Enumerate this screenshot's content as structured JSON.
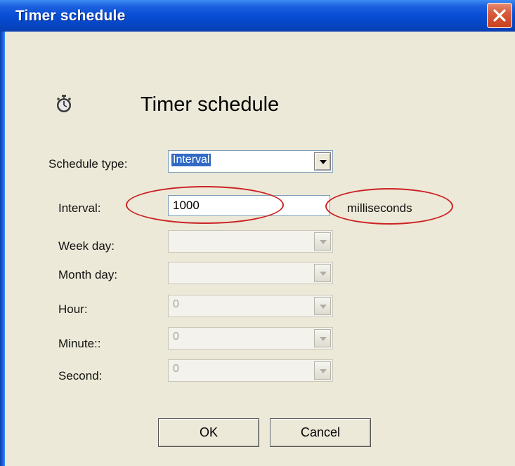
{
  "window": {
    "title": "Timer schedule"
  },
  "header": {
    "icon": "stopwatch-icon",
    "title": "Timer schedule"
  },
  "form": {
    "schedule_type": {
      "label": "Schedule type:",
      "value": "Interval"
    },
    "interval": {
      "label": "Interval:",
      "value": "1000",
      "unit": "milliseconds"
    },
    "week_day": {
      "label": "Week day:",
      "value": ""
    },
    "month_day": {
      "label": "Month day:",
      "value": ""
    },
    "hour": {
      "label": "Hour:",
      "value": "0"
    },
    "minute": {
      "label": "Minute::",
      "value": "0"
    },
    "second": {
      "label": "Second:",
      "value": "0"
    }
  },
  "buttons": {
    "ok": "OK",
    "cancel": "Cancel"
  },
  "colors": {
    "title_bar": "#0a4fd6",
    "dialog_bg": "#ece9d8",
    "annotation": "#cc2222"
  }
}
